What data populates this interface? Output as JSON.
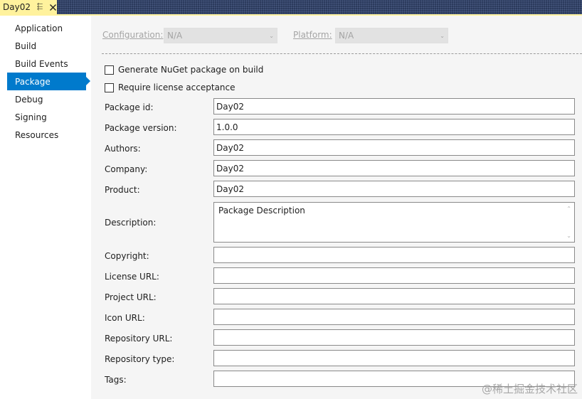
{
  "tab": {
    "title": "Day02"
  },
  "sidebar": {
    "items": [
      {
        "label": "Application"
      },
      {
        "label": "Build"
      },
      {
        "label": "Build Events"
      },
      {
        "label": "Package",
        "selected": true
      },
      {
        "label": "Debug"
      },
      {
        "label": "Signing"
      },
      {
        "label": "Resources"
      }
    ]
  },
  "config": {
    "configuration_label": "Configuration:",
    "configuration_value": "N/A",
    "platform_label": "Platform:",
    "platform_value": "N/A"
  },
  "package": {
    "generate_nuget_label": "Generate NuGet package on build",
    "generate_nuget_checked": false,
    "require_license_label": "Require license acceptance",
    "require_license_checked": false,
    "fields": {
      "package_id": {
        "label": "Package id:",
        "value": "Day02"
      },
      "package_version": {
        "label": "Package version:",
        "value": "1.0.0"
      },
      "authors": {
        "label": "Authors:",
        "value": "Day02"
      },
      "company": {
        "label": "Company:",
        "value": "Day02"
      },
      "product": {
        "label": "Product:",
        "value": "Day02"
      },
      "description": {
        "label": "Description:",
        "value": "Package Description"
      },
      "copyright": {
        "label": "Copyright:",
        "value": ""
      },
      "license_url": {
        "label": "License URL:",
        "value": ""
      },
      "project_url": {
        "label": "Project URL:",
        "value": ""
      },
      "icon_url": {
        "label": "Icon URL:",
        "value": ""
      },
      "repository_url": {
        "label": "Repository URL:",
        "value": ""
      },
      "repository_type": {
        "label": "Repository type:",
        "value": ""
      },
      "tags": {
        "label": "Tags:",
        "value": ""
      }
    }
  },
  "watermark": "@稀土掘金技术社区",
  "colors": {
    "tab_active": "#fff29d",
    "accent": "#007acc",
    "panel_bg": "#f5f5f5"
  }
}
